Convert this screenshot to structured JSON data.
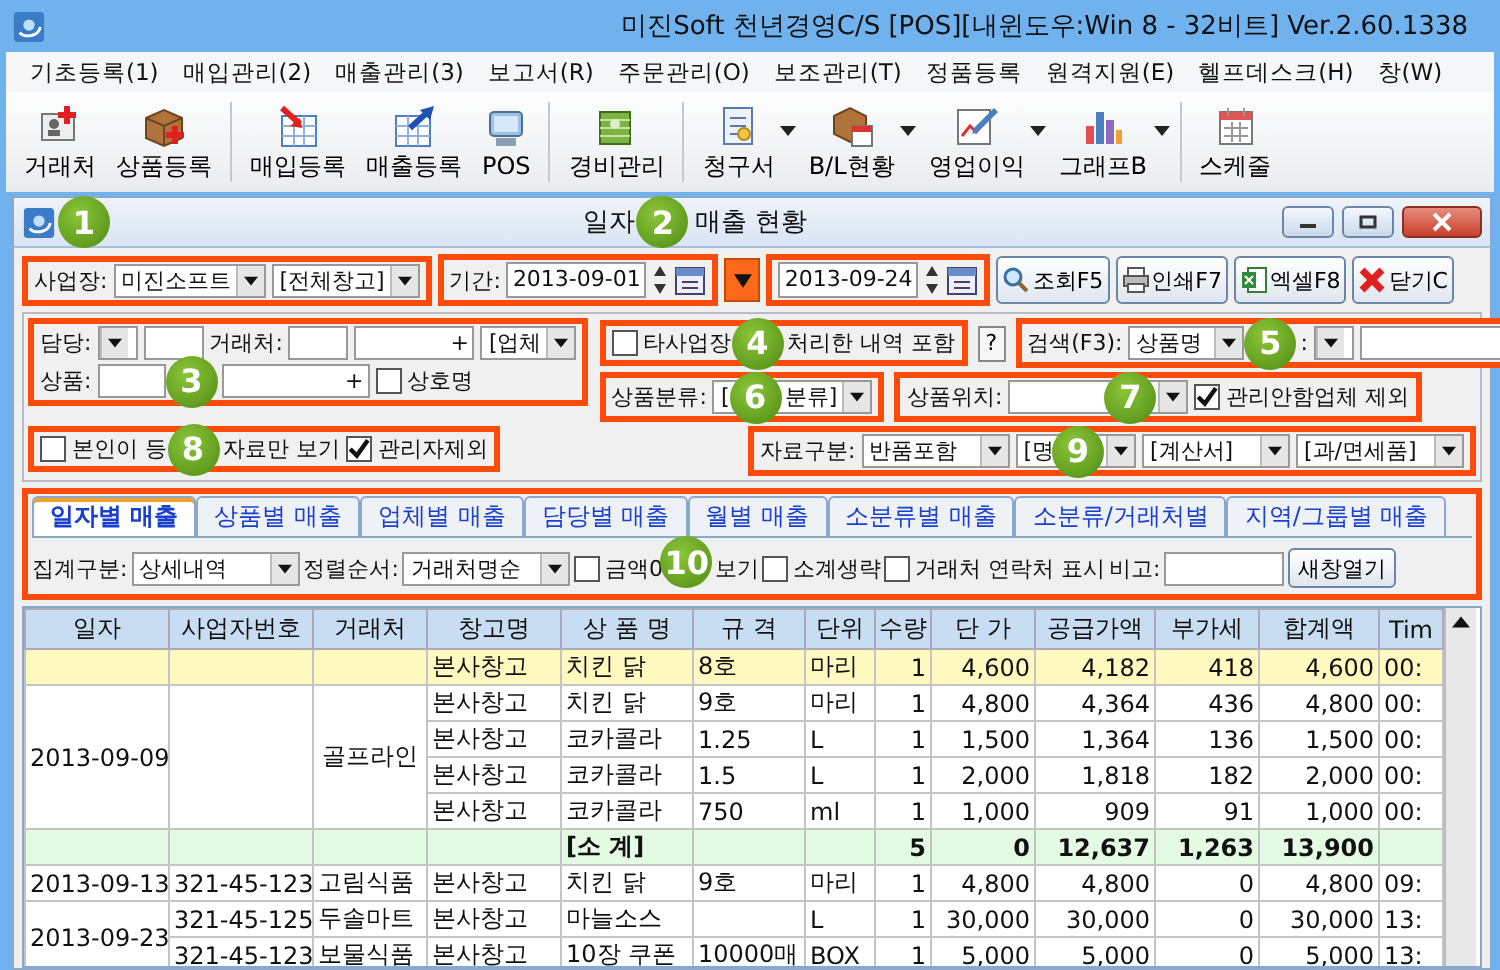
{
  "window": {
    "title": "미진Soft 천년경영C/S [POS][내윈도우:Win 8 - 32비트] Ver.2.60.1338"
  },
  "menu": [
    "기초등록(1)",
    "매입관리(2)",
    "매출관리(3)",
    "보고서(R)",
    "주문관리(O)",
    "보조관리(T)",
    "정품등록",
    "원격지원(E)",
    "헬프데스크(H)",
    "창(W)"
  ],
  "toolbar": [
    [
      {
        "label": "거래처",
        "dropdown": false
      },
      {
        "label": "상품등록",
        "dropdown": false
      }
    ],
    [
      {
        "label": "매입등록",
        "dropdown": false
      },
      {
        "label": "매출등록",
        "dropdown": false
      },
      {
        "label": "POS",
        "dropdown": false
      }
    ],
    [
      {
        "label": "경비관리",
        "dropdown": false
      }
    ],
    [
      {
        "label": "청구서",
        "dropdown": true
      },
      {
        "label": "B/L현황",
        "dropdown": true
      },
      {
        "label": "영업이익",
        "dropdown": true
      },
      {
        "label": "그래프B",
        "dropdown": true
      }
    ],
    [
      {
        "label": "스케줄",
        "dropdown": false
      }
    ]
  ],
  "report": {
    "badge": "1",
    "title_start": "일자",
    "title_badge": "2",
    "title_end": "매출 현황"
  },
  "site": {
    "label": "사업장:",
    "company": "미진소프트",
    "warehouse": "[전체창고]"
  },
  "period": {
    "label": "기간:",
    "start": "2013-09-01",
    "end": "2013-09-24"
  },
  "actions": [
    "조회F5",
    "인쇄F7",
    "엑셀F8",
    "닫기C"
  ],
  "filters": {
    "badge": "3",
    "staff_label": "담당:",
    "vendor_label": "거래처:",
    "vendor_plus": "+",
    "vendor_type": "[업체",
    "product_label": "상품:",
    "product_plus": "+",
    "trade_name": {
      "label": "상호명",
      "checked": false
    }
  },
  "other_site": {
    "checked": false,
    "before": "타사업장",
    "badge": "4",
    "after": "처리한 내역 포함",
    "help": "?"
  },
  "search": {
    "label": "검색(F3):",
    "field": "상품명",
    "badge": "5",
    "after": ":"
  },
  "category": {
    "label": "상품분류:",
    "before": "[",
    "badge": "6",
    "after": "분류]"
  },
  "location": {
    "label": "상품위치:",
    "badge": "7",
    "exclude": {
      "label": "관리안함업체 제외",
      "checked": true
    }
  },
  "own": {
    "checked": false,
    "before": "본인이 등",
    "badge": "8",
    "after": "자료만 보기"
  },
  "admin": {
    "label": "관리자제외",
    "checked": true
  },
  "data_type": {
    "label": "자료구분:",
    "returns": "반품포함",
    "doc_before": "[명",
    "badge": "9",
    "invoice": "[계산서]",
    "tax": "[과/면세품]"
  },
  "tabs": [
    {
      "label": "일자별 매출",
      "selected": true
    },
    {
      "label": "상품별 매출",
      "selected": false
    },
    {
      "label": "업체별 매출",
      "selected": false
    },
    {
      "label": "담당별 매출",
      "selected": false
    },
    {
      "label": "월별 매출",
      "selected": false
    },
    {
      "label": "소분류별 매출",
      "selected": false
    },
    {
      "label": "소분류/거래처별",
      "selected": false
    },
    {
      "label": "지역/그룹별 매출",
      "selected": false
    }
  ],
  "options": {
    "badge": "10",
    "group_label": "집계구분:",
    "group_value": "상세내역",
    "sort_label": "정렬순서:",
    "sort_value": "거래처명순",
    "zero": {
      "before": "금액0",
      "after": "보기",
      "checked": false
    },
    "subtotal": {
      "label": "소계생략",
      "checked": false
    },
    "contact": {
      "label": "거래처 연락처 표시",
      "checked": false
    },
    "memo_label": "비고:",
    "new_window": "새창열기"
  },
  "table": {
    "columns": [
      "일자",
      "사업자번호",
      "거래처",
      "창고명",
      "상 품 명",
      "규 격",
      "단위",
      "수량",
      "단 가",
      "공급가액",
      "부가세",
      "합계액",
      "Tim"
    ],
    "groups": [
      {
        "kind": "item",
        "rows": [
          {
            "selected": true,
            "cells": [
              "본사창고",
              "치킨 닭",
              "8호",
              "마리",
              "1",
              "4,600",
              "4,182",
              "418",
              "4,600",
              "00:"
            ]
          }
        ]
      },
      {
        "kind": "item",
        "date": "2013-09-09",
        "vendor": "골프라인",
        "rows": [
          {
            "selected": false,
            "cells": [
              "본사창고",
              "치킨 닭",
              "9호",
              "마리",
              "1",
              "4,800",
              "4,364",
              "436",
              "4,800",
              "00:"
            ]
          },
          {
            "selected": false,
            "cells": [
              "본사창고",
              "코카콜라",
              "1.25",
              "L",
              "1",
              "1,500",
              "1,364",
              "136",
              "1,500",
              "00:"
            ]
          },
          {
            "selected": false,
            "cells": [
              "본사창고",
              "코카콜라",
              "1.5",
              "L",
              "1",
              "2,000",
              "1,818",
              "182",
              "2,000",
              "00:"
            ]
          },
          {
            "selected": false,
            "cells": [
              "본사창고",
              "코카콜라",
              "750",
              "ml",
              "1",
              "1,000",
              "909",
              "91",
              "1,000",
              "00:"
            ]
          }
        ]
      },
      {
        "kind": "subtotal",
        "rows": [
          {
            "selected": false,
            "cells": [
              null,
              "[소 계]",
              null,
              null,
              "5",
              "0",
              "12,637",
              "1,263",
              "13,900",
              null
            ]
          }
        ]
      },
      {
        "kind": "item",
        "date": "2013-09-13",
        "rows": [
          {
            "selected": false,
            "business_no": "321-45-123",
            "vendor": "고림식품",
            "cells": [
              "본사창고",
              "치킨 닭",
              "9호",
              "마리",
              "1",
              "4,800",
              "4,800",
              "0",
              "4,800",
              "09:"
            ]
          }
        ]
      },
      {
        "kind": "item",
        "date": "2013-09-23",
        "rows": [
          {
            "selected": false,
            "business_no": "321-45-125",
            "vendor": "두솔마트",
            "cells": [
              "본사창고",
              "마늘소스",
              null,
              "L",
              "1",
              "30,000",
              "30,000",
              "0",
              "30,000",
              "13:"
            ]
          },
          {
            "selected": false,
            "business_no": "321-45-123",
            "vendor": "보물식품",
            "cells": [
              "본사창고",
              "10장 쿠폰",
              "10000매",
              "BOX",
              "1",
              "5,000",
              "5,000",
              "0",
              "5,000",
              "13:"
            ]
          }
        ]
      }
    ]
  }
}
